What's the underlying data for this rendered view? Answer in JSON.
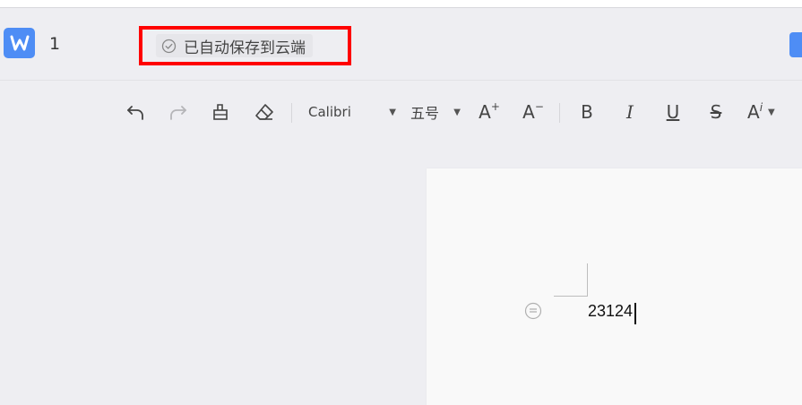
{
  "header": {
    "doc_name": "1",
    "save_status": "已自动保存到云端"
  },
  "toolbar": {
    "undo": "undo-icon",
    "redo": "redo-icon",
    "format_painter": "format-painter-icon",
    "clear_format": "eraser-icon",
    "font_name": "Calibri",
    "font_size": "五号",
    "grow_font": "A",
    "shrink_font": "A",
    "bold": "B",
    "italic": "I",
    "underline": "U",
    "strikethrough": "S",
    "text_effect": "A"
  },
  "document": {
    "text": "23124"
  },
  "colors": {
    "accent": "#4e8df5",
    "highlight_box": "#ff0000",
    "background": "#eeeef2"
  }
}
